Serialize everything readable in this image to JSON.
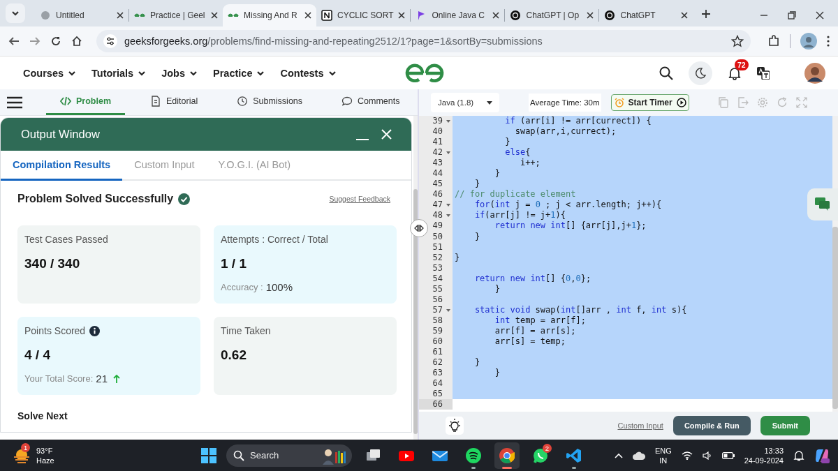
{
  "browser": {
    "tabs": [
      {
        "title": "Untitled",
        "selected": false
      },
      {
        "title": "Practice | Geel",
        "selected": false
      },
      {
        "title": "Missing And R",
        "selected": true
      },
      {
        "title": "CYCLIC SORT",
        "selected": false
      },
      {
        "title": "Online Java C",
        "selected": false
      },
      {
        "title": "ChatGPT | Op",
        "selected": false
      },
      {
        "title": "ChatGPT",
        "selected": false
      }
    ],
    "address": {
      "host": "geeksforgeeks.org",
      "path": "/problems/find-missing-and-repeating2512/1?page=1&sortBy=submissions"
    }
  },
  "site_nav": {
    "menus": [
      "Courses",
      "Tutorials",
      "Jobs",
      "Practice",
      "Contests"
    ],
    "notifications": "72"
  },
  "problem_tabs": [
    {
      "label": "Problem",
      "selected": true
    },
    {
      "label": "Editorial",
      "selected": false
    },
    {
      "label": "Submissions",
      "selected": false
    },
    {
      "label": "Comments",
      "selected": false
    }
  ],
  "output_window": {
    "title": "Output Window",
    "tabs": [
      {
        "label": "Compilation Results",
        "selected": true
      },
      {
        "label": "Custom Input",
        "selected": false
      },
      {
        "label": "Y.O.G.I. (AI Bot)",
        "selected": false
      }
    ],
    "status": "Problem Solved Successfully",
    "feedback_link": "Suggest Feedback",
    "cards": [
      {
        "kind": "plain",
        "label": "Test Cases Passed",
        "value": "340 / 340"
      },
      {
        "kind": "highlight",
        "label": "Attempts : Correct / Total",
        "value": "1 / 1",
        "note_label": "Accuracy :",
        "note_value": "100%"
      },
      {
        "kind": "highlight",
        "label": "Points Scored",
        "info": true,
        "value": "4 / 4",
        "note_label": "Your Total Score:",
        "note_value": "21",
        "trend_up": true
      },
      {
        "kind": "plain",
        "label": "Time Taken",
        "value": "0.62"
      }
    ],
    "solve_next": "Solve Next"
  },
  "editor": {
    "language": "Java (1.8)",
    "average_time": "Average Time: 30m",
    "timer_button": "Start Timer",
    "lines": [
      {
        "number": "39",
        "fold": true,
        "selected": true,
        "tokens": [
          {
            "kind": "keyword",
            "text": "          if"
          },
          {
            "kind": "plain",
            "text": " (arr[i] != arr[currect]) {"
          }
        ]
      },
      {
        "number": "40",
        "fold": false,
        "selected": true,
        "tokens": [
          {
            "kind": "plain",
            "text": "            swap(arr,i,currect);"
          }
        ]
      },
      {
        "number": "41",
        "fold": false,
        "selected": true,
        "tokens": [
          {
            "kind": "plain",
            "text": "          }"
          }
        ]
      },
      {
        "number": "42",
        "fold": true,
        "selected": true,
        "tokens": [
          {
            "kind": "keyword",
            "text": "          else"
          },
          {
            "kind": "plain",
            "text": "{"
          }
        ]
      },
      {
        "number": "43",
        "fold": false,
        "selected": true,
        "tokens": [
          {
            "kind": "plain",
            "text": "             i++;"
          }
        ]
      },
      {
        "number": "44",
        "fold": false,
        "selected": true,
        "tokens": [
          {
            "kind": "plain",
            "text": "        }"
          }
        ]
      },
      {
        "number": "45",
        "fold": false,
        "selected": true,
        "tokens": [
          {
            "kind": "plain",
            "text": "    }"
          }
        ]
      },
      {
        "number": "46",
        "fold": false,
        "selected": true,
        "tokens": [
          {
            "kind": "comment",
            "text": "// for duplicate element"
          }
        ]
      },
      {
        "number": "47",
        "fold": true,
        "selected": true,
        "tokens": [
          {
            "kind": "keyword",
            "text": "    for"
          },
          {
            "kind": "plain",
            "text": "("
          },
          {
            "kind": "keyword",
            "text": "int"
          },
          {
            "kind": "plain",
            "text": " j = "
          },
          {
            "kind": "number",
            "text": "0"
          },
          {
            "kind": "plain",
            "text": " ; j < arr.length; j++){"
          }
        ]
      },
      {
        "number": "48",
        "fold": true,
        "selected": true,
        "tokens": [
          {
            "kind": "keyword",
            "text": "    if"
          },
          {
            "kind": "plain",
            "text": "(arr[j] != j+"
          },
          {
            "kind": "number",
            "text": "1"
          },
          {
            "kind": "plain",
            "text": "){"
          }
        ]
      },
      {
        "number": "49",
        "fold": false,
        "selected": true,
        "tokens": [
          {
            "kind": "keyword",
            "text": "        return"
          },
          {
            "kind": "keyword",
            "text": " new"
          },
          {
            "kind": "keyword",
            "text": " int"
          },
          {
            "kind": "plain",
            "text": "[] {arr[j],j+"
          },
          {
            "kind": "number",
            "text": "1"
          },
          {
            "kind": "plain",
            "text": "};"
          }
        ]
      },
      {
        "number": "50",
        "fold": false,
        "selected": true,
        "tokens": [
          {
            "kind": "plain",
            "text": "    }"
          }
        ]
      },
      {
        "number": "51",
        "fold": false,
        "selected": true
      },
      {
        "number": "52",
        "fold": false,
        "selected": true,
        "tokens": [
          {
            "kind": "plain",
            "text": "}"
          }
        ]
      },
      {
        "number": "53",
        "fold": false,
        "selected": true
      },
      {
        "number": "54",
        "fold": false,
        "selected": true,
        "tokens": [
          {
            "kind": "keyword",
            "text": "    return"
          },
          {
            "kind": "keyword",
            "text": " new"
          },
          {
            "kind": "keyword",
            "text": " int"
          },
          {
            "kind": "plain",
            "text": "[] {"
          },
          {
            "kind": "number",
            "text": "0"
          },
          {
            "kind": "plain",
            "text": ","
          },
          {
            "kind": "number",
            "text": "0"
          },
          {
            "kind": "plain",
            "text": "};"
          }
        ]
      },
      {
        "number": "55",
        "fold": false,
        "selected": true,
        "tokens": [
          {
            "kind": "plain",
            "text": "        }"
          }
        ]
      },
      {
        "number": "56",
        "fold": false,
        "selected": true
      },
      {
        "number": "57",
        "fold": true,
        "selected": true,
        "tokens": [
          {
            "kind": "keyword",
            "text": "    static"
          },
          {
            "kind": "keyword",
            "text": " void"
          },
          {
            "kind": "plain",
            "text": " swap("
          },
          {
            "kind": "keyword",
            "text": "int"
          },
          {
            "kind": "plain",
            "text": "[]arr , "
          },
          {
            "kind": "keyword",
            "text": "int"
          },
          {
            "kind": "plain",
            "text": " f, "
          },
          {
            "kind": "keyword",
            "text": "int"
          },
          {
            "kind": "plain",
            "text": " s){"
          }
        ]
      },
      {
        "number": "58",
        "fold": false,
        "selected": true,
        "tokens": [
          {
            "kind": "keyword",
            "text": "        int"
          },
          {
            "kind": "plain",
            "text": " temp = arr[f];"
          }
        ]
      },
      {
        "number": "59",
        "fold": false,
        "selected": true,
        "tokens": [
          {
            "kind": "plain",
            "text": "        arr[f] = arr[s];"
          }
        ]
      },
      {
        "number": "60",
        "fold": false,
        "selected": true,
        "tokens": [
          {
            "kind": "plain",
            "text": "        arr[s] = temp;"
          }
        ]
      },
      {
        "number": "61",
        "fold": false,
        "selected": true
      },
      {
        "number": "62",
        "fold": false,
        "selected": true,
        "tokens": [
          {
            "kind": "plain",
            "text": "    }"
          }
        ]
      },
      {
        "number": "63",
        "fold": false,
        "selected": true,
        "tokens": [
          {
            "kind": "plain",
            "text": "        }"
          }
        ]
      },
      {
        "number": "64",
        "fold": false,
        "selected": true
      },
      {
        "number": "65",
        "fold": false,
        "selected": true
      },
      {
        "number": "66",
        "fold": false,
        "selected": false
      }
    ],
    "footer": {
      "custom_input": "Custom Input",
      "compile_button": "Compile & Run",
      "submit_button": "Submit"
    }
  },
  "taskbar": {
    "weather": {
      "badge": "1",
      "temperature": "93°F",
      "condition": "Haze"
    },
    "search": {
      "placeholder": "Search"
    },
    "apps": [
      {
        "open": false,
        "selected": false
      },
      {
        "open": false,
        "selected": false
      },
      {
        "open": false,
        "selected": false
      },
      {
        "open": true,
        "selected": false
      },
      {
        "open": true,
        "selected": true
      },
      {
        "open": false,
        "selected": false,
        "badge": "2"
      },
      {
        "open": true,
        "selected": false
      }
    ],
    "language": "ENG",
    "region": "IN",
    "time": "13:33",
    "date": "24-09-2024"
  }
}
